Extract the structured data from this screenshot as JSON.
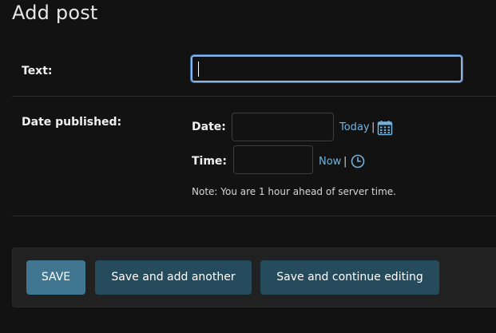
{
  "page": {
    "title": "Add post"
  },
  "fields": {
    "text": {
      "label": "Text:",
      "value": ""
    },
    "date_published": {
      "label": "Date published:",
      "date": {
        "label": "Date:",
        "value": "",
        "shortcut": "Today",
        "separator": "|",
        "icon": "calendar-icon"
      },
      "time": {
        "label": "Time:",
        "value": "",
        "shortcut": "Now",
        "separator": "|",
        "icon": "clock-icon"
      },
      "note": "Note: You are 1 hour ahead of server time."
    }
  },
  "actions": {
    "save": "SAVE",
    "save_add_another": "Save and add another",
    "save_continue": "Save and continue editing"
  },
  "colors": {
    "background": "#121212",
    "link": "#73b2de",
    "primary_button": "#417690",
    "secondary_button": "#264b5d"
  }
}
